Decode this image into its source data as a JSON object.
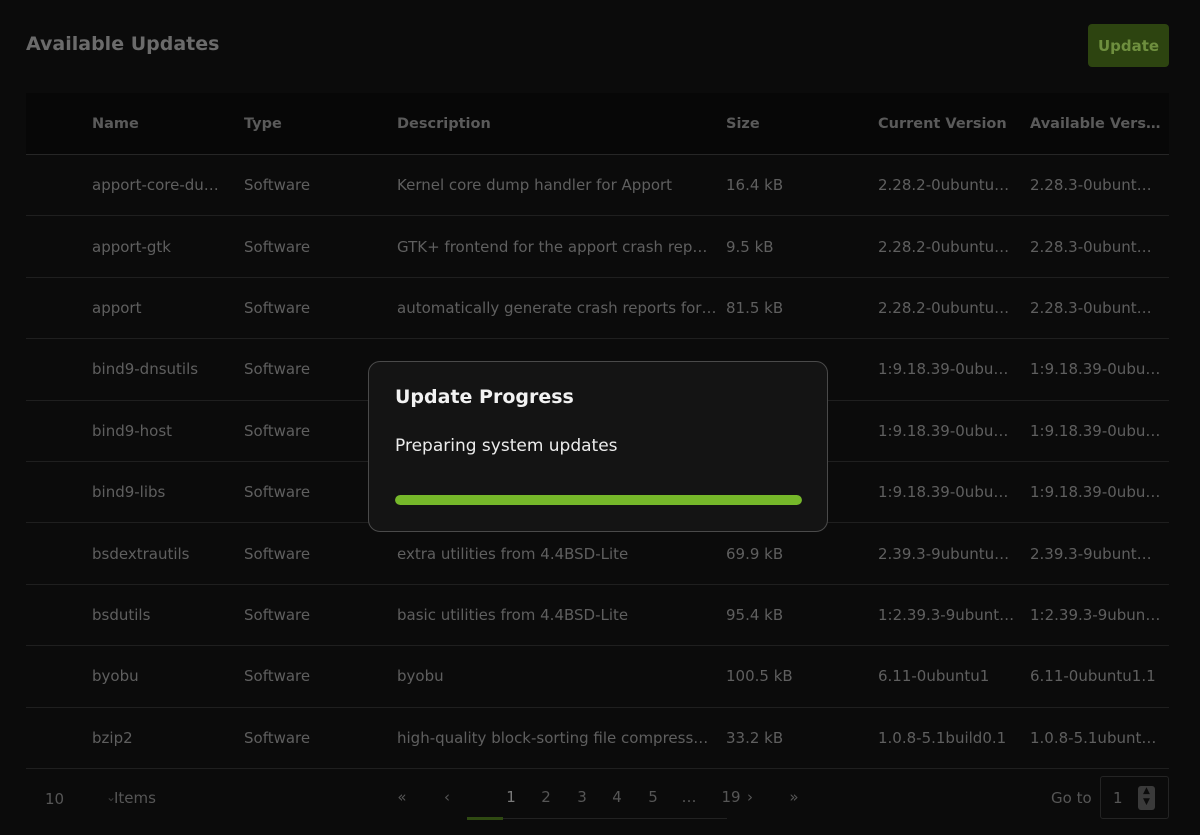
{
  "header": {
    "title": "Available Updates",
    "update_label": "Update"
  },
  "table": {
    "columns": [
      "Name",
      "Type",
      "Description",
      "Size",
      "Current Version",
      "Available Versi…"
    ],
    "rows": [
      {
        "name": "apport-core-du…",
        "type": "Software",
        "description": "Kernel core dump handler for Apport",
        "size": "16.4 kB",
        "current": "2.28.2-0ubuntu…",
        "available": "2.28.3-0ubuntu…"
      },
      {
        "name": "apport-gtk",
        "type": "Software",
        "description": "GTK+ frontend for the apport crash rep…",
        "size": "9.5 kB",
        "current": "2.28.2-0ubuntu…",
        "available": "2.28.3-0ubuntu…"
      },
      {
        "name": "apport",
        "type": "Software",
        "description": "automatically generate crash reports for…",
        "size": "81.5 kB",
        "current": "2.28.2-0ubuntu…",
        "available": "2.28.3-0ubuntu…"
      },
      {
        "name": "bind9-dnsutils",
        "type": "Software",
        "description": "",
        "size": "",
        "current": "1:9.18.39-0ubu…",
        "available": "1:9.18.39-0ubu…"
      },
      {
        "name": "bind9-host",
        "type": "Software",
        "description": "",
        "size": "",
        "current": "1:9.18.39-0ubu…",
        "available": "1:9.18.39-0ubu…"
      },
      {
        "name": "bind9-libs",
        "type": "Software",
        "description": "",
        "size": "",
        "current": "1:9.18.39-0ubu…",
        "available": "1:9.18.39-0ubu…"
      },
      {
        "name": "bsdextrautils",
        "type": "Software",
        "description": "extra utilities from 4.4BSD-Lite",
        "size": "69.9 kB",
        "current": "2.39.3-9ubuntu…",
        "available": "2.39.3-9ubuntu…"
      },
      {
        "name": "bsdutils",
        "type": "Software",
        "description": "basic utilities from 4.4BSD-Lite",
        "size": "95.4 kB",
        "current": "1:2.39.3-9ubunt…",
        "available": "1:2.39.3-9ubunt…"
      },
      {
        "name": "byobu",
        "type": "Software",
        "description": "byobu",
        "size": "100.5 kB",
        "current": "6.11-0ubuntu1",
        "available": "6.11-0ubuntu1.1"
      },
      {
        "name": "bzip2",
        "type": "Software",
        "description": "high-quality block-sorting file compress…",
        "size": "33.2 kB",
        "current": "1.0.8-5.1build0.1",
        "available": "1.0.8-5.1ubuntu…"
      }
    ]
  },
  "footer": {
    "page_size": "10",
    "items_label": "Items",
    "pages": [
      "1",
      "2",
      "3",
      "4",
      "5",
      "…",
      "19"
    ],
    "current_page": "1",
    "first_icon": "«",
    "prev_icon": "‹",
    "next_icon": "›",
    "last_icon": "»",
    "goto_label": "Go to",
    "goto_value": "1"
  },
  "modal": {
    "title": "Update Progress",
    "message": "Preparing system updates",
    "progress_percent": 100,
    "accent_color": "#76b82a"
  }
}
